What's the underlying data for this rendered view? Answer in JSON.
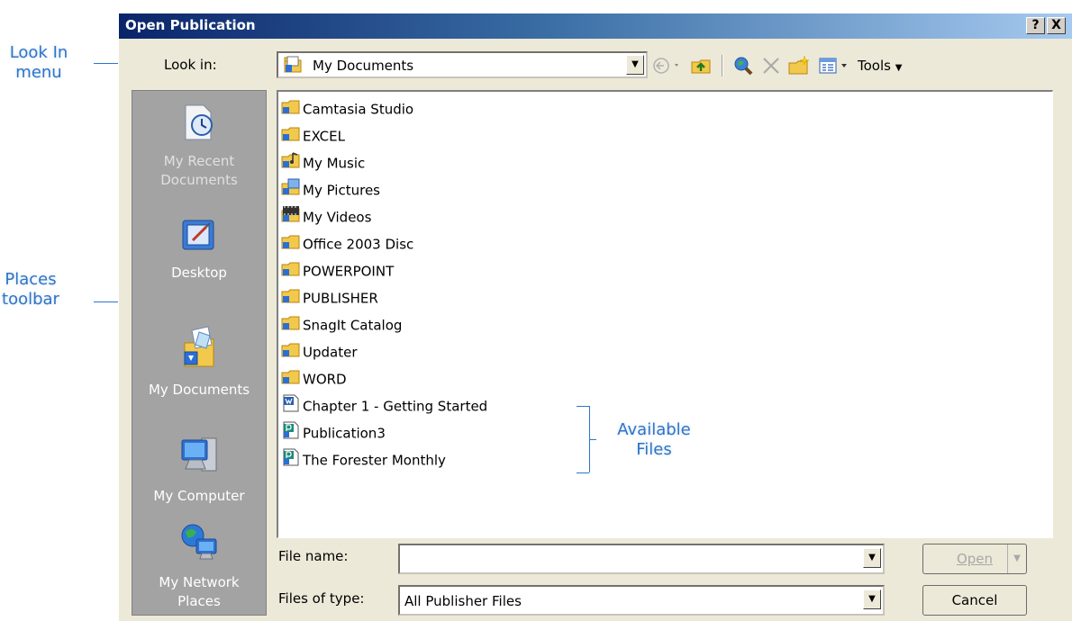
{
  "annotations": {
    "look_in": [
      "Look In",
      "menu"
    ],
    "places": [
      "Places",
      "toolbar"
    ],
    "available": [
      "Available",
      "Files"
    ]
  },
  "dialog": {
    "title": "Open Publication",
    "help_button": "?",
    "close_button": "X"
  },
  "look_in": {
    "label": "Look in:",
    "value": "My Documents"
  },
  "toolbar": {
    "tools_label": "Tools"
  },
  "places": [
    {
      "label_lines": [
        "My Recent",
        "Documents"
      ],
      "icon": "recent-documents-icon",
      "dim": true
    },
    {
      "label_lines": [
        "Desktop"
      ],
      "icon": "desktop-icon",
      "dim": false
    },
    {
      "label_lines": [
        "My Documents"
      ],
      "icon": "my-documents-icon",
      "dim": false
    },
    {
      "label_lines": [
        "My Computer"
      ],
      "icon": "my-computer-icon",
      "dim": false
    },
    {
      "label_lines": [
        "My Network",
        "Places"
      ],
      "icon": "network-places-icon",
      "dim": false
    }
  ],
  "files": [
    {
      "name": "Camtasia Studio",
      "icon": "folder"
    },
    {
      "name": "EXCEL",
      "icon": "folder"
    },
    {
      "name": "My Music",
      "icon": "music-folder"
    },
    {
      "name": "My Pictures",
      "icon": "pictures-folder"
    },
    {
      "name": "My Videos",
      "icon": "videos-folder"
    },
    {
      "name": "Office 2003 Disc",
      "icon": "folder"
    },
    {
      "name": "POWERPOINT",
      "icon": "folder"
    },
    {
      "name": "PUBLISHER",
      "icon": "folder"
    },
    {
      "name": "SnagIt Catalog",
      "icon": "folder"
    },
    {
      "name": "Updater",
      "icon": "folder"
    },
    {
      "name": "WORD",
      "icon": "folder"
    },
    {
      "name": "Chapter 1 - Getting Started",
      "icon": "word-doc"
    },
    {
      "name": "Publication3",
      "icon": "publisher-doc"
    },
    {
      "name": "The Forester Monthly",
      "icon": "publisher-doc"
    }
  ],
  "file_name": {
    "label": "File name:",
    "value": ""
  },
  "file_type": {
    "label": "Files of type:",
    "value": "All Publisher Files"
  },
  "buttons": {
    "open": "Open",
    "cancel": "Cancel"
  },
  "colors": {
    "annotation": "#2e74c9",
    "dialog_bg": "#ece9d8",
    "places_bg": "#a3a3a3"
  }
}
